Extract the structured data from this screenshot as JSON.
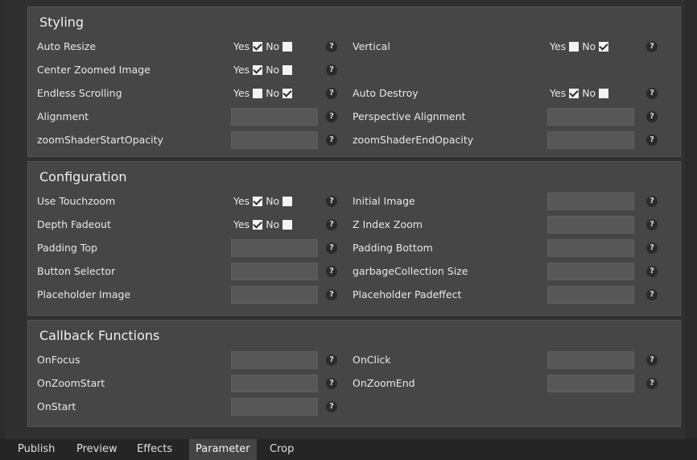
{
  "panels": {
    "styling": {
      "title": "Styling",
      "rows": [
        {
          "label": "Auto Resize",
          "yes": "Yes",
          "no": "No",
          "yes_checked": true,
          "no_checked": false
        },
        {
          "label": "Center Zoomed Image",
          "yes": "Yes",
          "no": "No",
          "yes_checked": true,
          "no_checked": false
        },
        {
          "label": "Endless Scrolling",
          "yes": "Yes",
          "no": "No",
          "yes_checked": false,
          "no_checked": true
        },
        {
          "label": "Alignment",
          "value": ""
        },
        {
          "label": "zoomShaderStartOpacity",
          "value": ""
        }
      ],
      "rows_right": [
        {
          "label": "Vertical",
          "yes": "Yes",
          "no": "No",
          "yes_checked": false,
          "no_checked": true
        },
        {
          "label": "Auto Destroy",
          "yes": "Yes",
          "no": "No",
          "yes_checked": true,
          "no_checked": false
        },
        {
          "label": "Perspective Alignment",
          "value": ""
        },
        {
          "label": "zoomShaderEndOpacity",
          "value": ""
        }
      ]
    },
    "configuration": {
      "title": "Configuration",
      "rows": [
        {
          "label": "Use Touchzoom",
          "yes": "Yes",
          "no": "No",
          "yes_checked": true,
          "no_checked": false
        },
        {
          "label": "Depth Fadeout",
          "yes": "Yes",
          "no": "No",
          "yes_checked": true,
          "no_checked": false
        },
        {
          "label": "Padding Top",
          "value": ""
        },
        {
          "label": "Button Selector",
          "value": ""
        },
        {
          "label": "Placeholder Image",
          "value": ""
        }
      ],
      "rows_right": [
        {
          "label": "Initial Image",
          "value": ""
        },
        {
          "label": "Z Index Zoom",
          "value": ""
        },
        {
          "label": "Padding Bottom",
          "value": ""
        },
        {
          "label": "garbageCollection Size",
          "value": ""
        },
        {
          "label": "Placeholder Padeffect",
          "value": ""
        }
      ]
    },
    "callbacks": {
      "title": "Callback Functions",
      "rows": [
        {
          "label": "OnFocus",
          "value": ""
        },
        {
          "label": "OnZoomStart",
          "value": ""
        },
        {
          "label": "OnStart",
          "value": ""
        }
      ],
      "rows_right": [
        {
          "label": "OnClick",
          "value": ""
        },
        {
          "label": "OnZoomEnd",
          "value": ""
        }
      ]
    }
  },
  "help_glyph": "?",
  "tabs": [
    "Publish",
    "Preview",
    "Effects",
    "Parameter",
    "Crop"
  ],
  "active_tab": "Parameter",
  "colors": {
    "panel": "#464646",
    "field": "#575757",
    "background": "#303030"
  }
}
